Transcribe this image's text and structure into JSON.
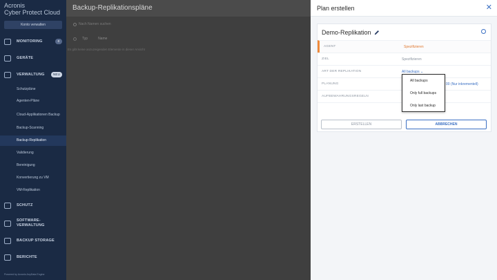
{
  "sidebar": {
    "brand_line1": "Acronis",
    "brand_line2": "Cyber Protect Cloud",
    "manage_button": "Konto verwalten",
    "main": [
      {
        "label": "MONITORING",
        "badge": "0"
      },
      {
        "label": "GERÄTE"
      },
      {
        "label": "VERWALTUNG",
        "badge": "NEU"
      },
      {
        "label": "SCHUTZ"
      },
      {
        "label": "SOFTWARE-VERWALTUNG"
      },
      {
        "label": "BACKUP STORAGE"
      },
      {
        "label": "BERICHTE"
      }
    ],
    "sub_items": [
      "Schutzpläne",
      "Agenten-Pläne",
      "Cloud-Applikationen Backup",
      "Backup-Scanning",
      "Backup-Replikation",
      "Validierung",
      "Bereinigung",
      "Konvertierung zu VM",
      "VM-Replikation"
    ],
    "powered_by": "Powered by Acronis AnyData Engine"
  },
  "main": {
    "title": "Backup-Replikationspläne",
    "search_placeholder": "Nach Namen suchen",
    "columns": [
      "Typ",
      "Name"
    ],
    "empty_text": "Es gibt keine anzuzeigenden Elemente in dieser Ansicht"
  },
  "drawer": {
    "title": "Plan erstellen",
    "plan_name": "Demo-Replikation",
    "rows": [
      {
        "label": "AGENT",
        "value": "Spezifizieren"
      },
      {
        "label": "ZIEL",
        "value": "Spezifizieren"
      },
      {
        "label": "ART DER REPLIKATION",
        "value": "All backups"
      },
      {
        "label": "PLANUNG",
        "value": "",
        "value_right": "00 (Nur inkrementell)"
      },
      {
        "label": "AUFBEWAHRUNGSREGELN",
        "value": ""
      }
    ],
    "create_button": "ERSTELLEN",
    "cancel_button": "ABBRECHEN"
  },
  "dropdown": {
    "options": [
      "All backups",
      "Only full backups",
      "Only last backup"
    ]
  },
  "colors": {
    "sidebar_bg": "#1a2a44",
    "accent": "#3a6fc3",
    "orange": "#e07a32"
  }
}
